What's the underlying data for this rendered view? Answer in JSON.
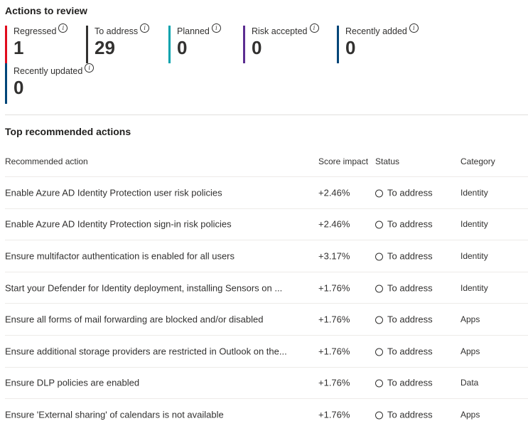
{
  "actions_to_review": {
    "title": "Actions to review",
    "cards": [
      {
        "label": "Regressed",
        "value": "1",
        "color": "#e00b1c"
      },
      {
        "label": "To address",
        "value": "29",
        "color": "#323130"
      },
      {
        "label": "Planned",
        "value": "0",
        "color": "#00a2ad"
      },
      {
        "label": "Risk accepted",
        "value": "0",
        "color": "#5c2e91"
      },
      {
        "label": "Recently added",
        "value": "0",
        "color": "#004578"
      },
      {
        "label": "Recently updated",
        "value": "0",
        "color": "#004578"
      }
    ],
    "info_icon": "i"
  },
  "top_actions": {
    "title": "Top recommended actions",
    "columns": {
      "action": "Recommended action",
      "score": "Score impact",
      "status": "Status",
      "category": "Category"
    },
    "rows": [
      {
        "action": "Enable Azure AD Identity Protection user risk policies",
        "score": "+2.46%",
        "status": "To address",
        "category": "Identity"
      },
      {
        "action": "Enable Azure AD Identity Protection sign-in risk policies",
        "score": "+2.46%",
        "status": "To address",
        "category": "Identity"
      },
      {
        "action": "Ensure multifactor authentication is enabled for all users",
        "score": "+3.17%",
        "status": "To address",
        "category": "Identity"
      },
      {
        "action": "Start your Defender for Identity deployment, installing Sensors on ...",
        "score": "+1.76%",
        "status": "To address",
        "category": "Identity"
      },
      {
        "action": "Ensure all forms of mail forwarding are blocked and/or disabled",
        "score": "+1.76%",
        "status": "To address",
        "category": "Apps"
      },
      {
        "action": "Ensure additional storage providers are restricted in Outlook on the...",
        "score": "+1.76%",
        "status": "To address",
        "category": "Apps"
      },
      {
        "action": "Ensure DLP policies are enabled",
        "score": "+1.76%",
        "status": "To address",
        "category": "Data"
      },
      {
        "action": "Ensure 'External sharing' of calendars is not available",
        "score": "+1.76%",
        "status": "To address",
        "category": "Apps"
      }
    ]
  }
}
